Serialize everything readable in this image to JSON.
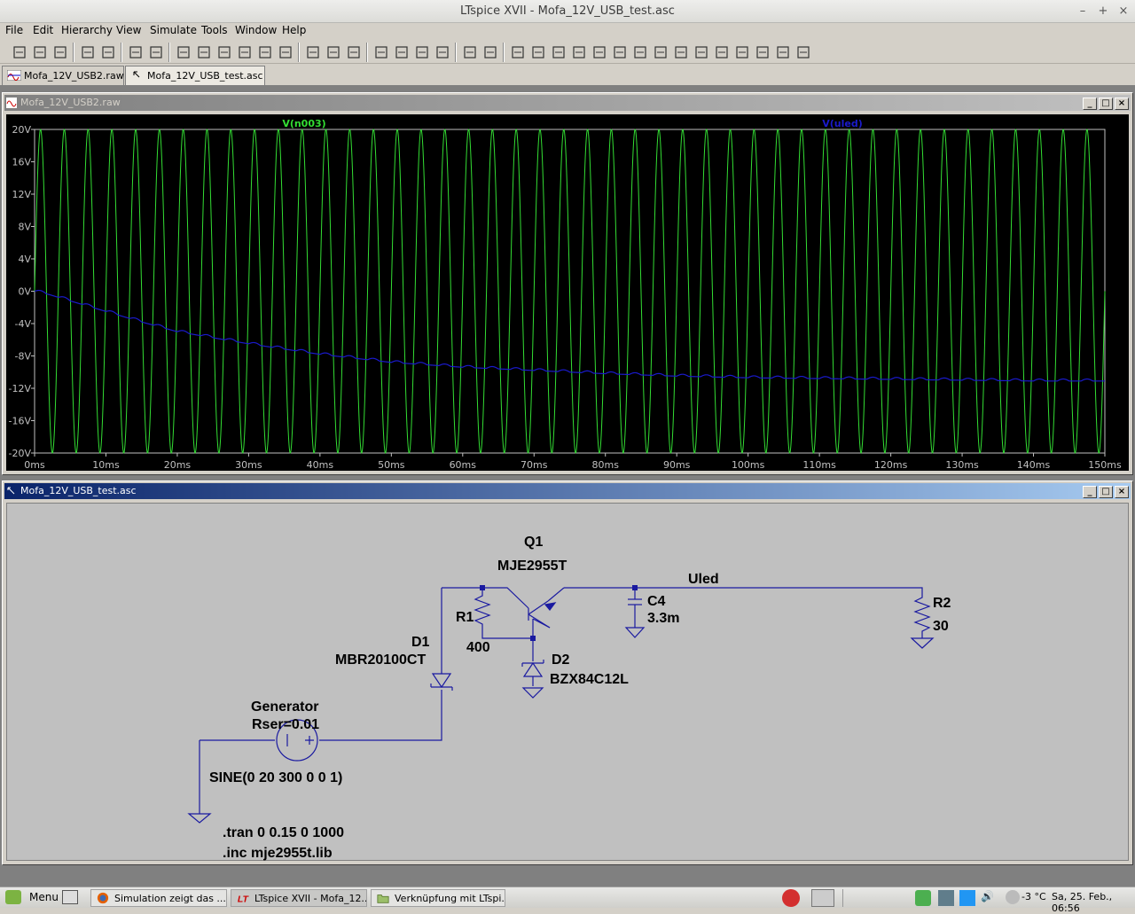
{
  "window": {
    "title": "LTspice XVII - Mofa_12V_USB_test.asc",
    "minimize": "–",
    "maximize": "+",
    "close": "×"
  },
  "menu": [
    "File",
    "Edit",
    "Hierarchy",
    "View",
    "Simulate",
    "Tools",
    "Window",
    "Help"
  ],
  "toolbar_icons": [
    "new-schematic-icon",
    "open-icon",
    "save-icon",
    "control-panel-icon",
    "run-icon",
    "halt-icon",
    "zoom-in-icon",
    "zoom-pan-icon",
    "zoom-out-icon",
    "zoom-fit-icon",
    "autorange-icon",
    "autorange-y-icon",
    "tile-horizontal-icon",
    "cascade-icon",
    "tile-vertical-icon",
    "cut-icon",
    "copy-icon",
    "paste-icon",
    "find-icon",
    "print-setup-icon",
    "print-icon",
    "wire-icon",
    "ground-icon",
    "label-net-icon",
    "resistor-icon",
    "capacitor-icon",
    "inductor-icon",
    "diode-icon",
    "component-icon",
    "move-icon",
    "drag-icon",
    "undo-icon",
    "redo-icon",
    "rotate-icon",
    "mirror-icon",
    "text-icon",
    "spice-directive-icon"
  ],
  "tabs": [
    {
      "label": "Mofa_12V_USB2.raw",
      "active": false
    },
    {
      "label": "Mofa_12V_USB_test.asc",
      "active": true
    }
  ],
  "waveform_window": {
    "title": "Mofa_12V_USB2.raw"
  },
  "chart_data": {
    "type": "line",
    "title": "",
    "xlabel": "",
    "ylabel": "",
    "xlim": [
      0,
      150
    ],
    "ylim": [
      -20,
      20
    ],
    "x_unit": "ms",
    "y_unit": "V",
    "x_ticks": [
      "0ms",
      "10ms",
      "20ms",
      "30ms",
      "40ms",
      "50ms",
      "60ms",
      "70ms",
      "80ms",
      "90ms",
      "100ms",
      "110ms",
      "120ms",
      "130ms",
      "140ms",
      "150ms"
    ],
    "y_ticks": [
      "20V",
      "16V",
      "12V",
      "8V",
      "4V",
      "0V",
      "-4V",
      "-8V",
      "-12V",
      "-16V",
      "-20V"
    ],
    "grid": false,
    "background": "#000000",
    "series": [
      {
        "name": "V(n003)",
        "color": "#33dd33",
        "kind": "sine",
        "amplitude": 20,
        "frequency_hz": 300,
        "offset": 0
      },
      {
        "name": "V(uled)",
        "color": "#1a1acc",
        "kind": "charging",
        "x": [
          0,
          2,
          5,
          10,
          15,
          20,
          30,
          40,
          50,
          60,
          70,
          80,
          90,
          100,
          110,
          120,
          130,
          140,
          150
        ],
        "y": [
          0,
          -0.4,
          -1.2,
          -2.5,
          -3.8,
          -5.0,
          -6.5,
          -7.8,
          -8.8,
          -9.4,
          -9.8,
          -10.2,
          -10.5,
          -10.7,
          -10.8,
          -10.9,
          -11.0,
          -11.1,
          -11.1
        ]
      }
    ]
  },
  "schematic_window": {
    "title": "Mofa_12V_USB_test.asc"
  },
  "schematic": {
    "q1_name": "Q1",
    "q1_model": "MJE2955T",
    "net_label": "Uled",
    "r1_name": "R1",
    "r1_value": "400",
    "c4_name": "C4",
    "c4_value": "3.3m",
    "r2_name": "R2",
    "r2_value": "30",
    "d1_name": "D1",
    "d1_model": "MBR20100CT",
    "d2_name": "D2",
    "d2_model": "BZX84C12L",
    "gen_name": "Generator",
    "gen_rser": "Rser=0.01",
    "gen_value": "SINE(0 20 300 0 0 1)",
    "directive_tran": ".tran 0 0.15 0 1000",
    "directive_inc": ".inc mje2955t.lib"
  },
  "taskbar": {
    "menu_label": "Menu",
    "tasks": [
      {
        "label": "Simulation zeigt das ...",
        "icon": "firefox-icon",
        "active": false
      },
      {
        "label": "LTspice XVII - Mofa_12...",
        "icon": "ltspice-icon",
        "active": true
      },
      {
        "label": "Verknüpfung mit LTspi...",
        "icon": "folder-icon",
        "active": false
      }
    ],
    "temperature": "-3 °C",
    "datetime": "Sa, 25. Feb., 06:56"
  }
}
